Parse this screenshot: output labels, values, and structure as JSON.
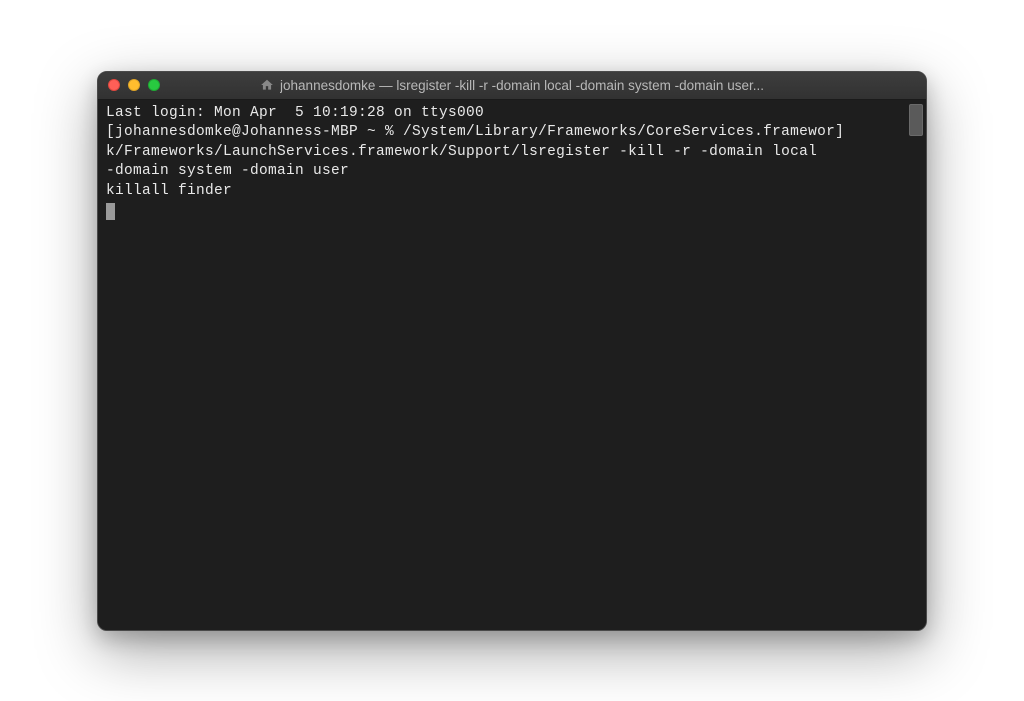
{
  "window": {
    "title": "johannesdomke — lsregister -kill -r -domain local -domain system -domain user..."
  },
  "terminal": {
    "line1": "Last login: Mon Apr  5 10:19:28 on ttys000",
    "line2": "[johannesdomke@Johanness-MBP ~ % /System/Library/Frameworks/CoreServices.framewor]",
    "line3": "k/Frameworks/LaunchServices.framework/Support/lsregister -kill -r -domain local ",
    "line4": "-domain system -domain user",
    "line5": "killall finder"
  }
}
